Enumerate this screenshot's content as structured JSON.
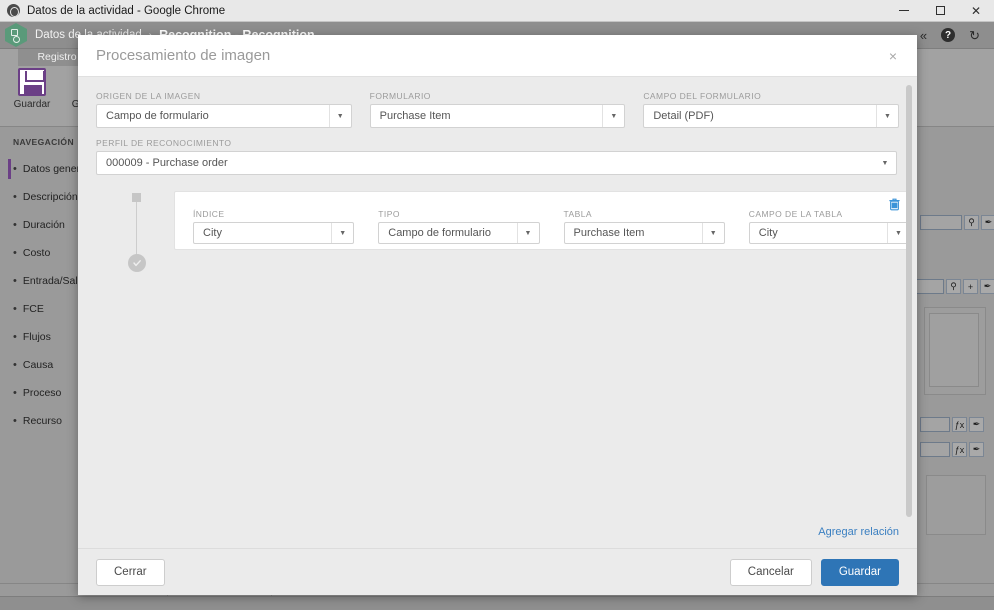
{
  "window": {
    "title": "Datos de la actividad - Google Chrome",
    "favicon_name": "chrome-favicon",
    "minimize_label": "─",
    "maximize_label": "□",
    "close_label": "×"
  },
  "appbar": {
    "breadcrumb_root": "Datos de la actividad",
    "breadcrumb_separator": "›",
    "breadcrumb_current": "Recognition - Recognition",
    "icons": [
      {
        "name": "collapse-ribbon-icon",
        "glyph": "«"
      },
      {
        "name": "help-icon",
        "glyph": "?"
      },
      {
        "name": "refresh-icon",
        "glyph": "↻"
      }
    ]
  },
  "ribbon": {
    "tab_label": "Registro",
    "buttons": [
      {
        "name": "save-button",
        "label": "Guardar"
      },
      {
        "name": "save-and-close-button",
        "label": "Guardar y"
      }
    ]
  },
  "sidebar": {
    "title": "NAVEGACIÓN",
    "items": [
      {
        "label": "Datos genera",
        "active": true
      },
      {
        "label": "Descripción",
        "active": false
      },
      {
        "label": "Duración",
        "active": false
      },
      {
        "label": "Costo",
        "active": false
      },
      {
        "label": "Entrada/Salid",
        "active": false
      },
      {
        "label": "FCE",
        "active": false
      },
      {
        "label": "Flujos",
        "active": false
      },
      {
        "label": "Causa",
        "active": false
      },
      {
        "label": "Proceso",
        "active": false
      },
      {
        "label": "Recurso",
        "active": false
      }
    ],
    "bullet": "•"
  },
  "right_panel": {
    "icons": [
      {
        "name": "search-icon",
        "glyph": "⚲"
      },
      {
        "name": "eraser-icon",
        "glyph": "✒"
      },
      {
        "name": "add-icon",
        "glyph": "+"
      },
      {
        "name": "formula-icon",
        "glyph": "ƒx"
      }
    ]
  },
  "modal": {
    "title": "Procesamiento de imagen",
    "close_label": "×",
    "fields": {
      "origen": {
        "label": "ORIGEN DE LA IMAGEN",
        "value": "Campo de formulario"
      },
      "formulario": {
        "label": "FORMULARIO",
        "value": "Purchase Item"
      },
      "campo_formulario": {
        "label": "CAMPO DEL FORMULARIO",
        "value": "Detail (PDF)"
      },
      "perfil": {
        "label": "PERFIL DE RECONOCIMIENTO",
        "value": "000009 - Purchase order"
      }
    },
    "relation": {
      "delete_icon_name": "delete-relation-icon",
      "delete_icon_color": "#3a93d8",
      "fields": {
        "indice": {
          "label": "ÍNDICE",
          "value": "City"
        },
        "tipo": {
          "label": "TIPO",
          "value": "Campo de formulario"
        },
        "tabla": {
          "label": "TABLA",
          "value": "Purchase Item"
        },
        "campo_tabla": {
          "label": "CAMPO DE LA TABLA",
          "value": "City"
        }
      }
    },
    "add_relation_link": "Agregar relación",
    "footer": {
      "close_button": "Cerrar",
      "cancel_button": "Cancelar",
      "save_button": "Guardar",
      "save_button_color": "#2e75b6"
    },
    "caret_glyph": "▼"
  }
}
